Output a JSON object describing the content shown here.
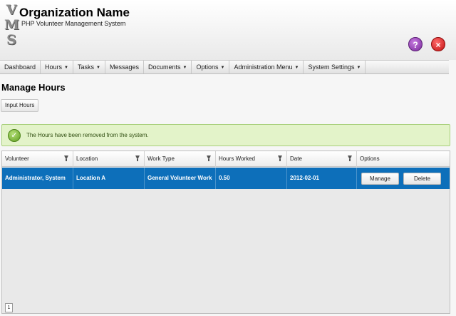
{
  "header": {
    "logo_letters": [
      "V",
      "M",
      "S"
    ],
    "org_name": "Organization Name",
    "subtitle": "PHP Volunteer Management System",
    "top_right": "",
    "help_label": "?",
    "close_label": "×"
  },
  "nav": {
    "items": [
      {
        "label": "Dashboard",
        "caret": ""
      },
      {
        "label": "Hours",
        "caret": "▼"
      },
      {
        "label": "Tasks",
        "caret": "▼"
      },
      {
        "label": "Messages",
        "caret": ""
      },
      {
        "label": "Documents",
        "caret": "▼"
      },
      {
        "label": "Options",
        "caret": "▼"
      },
      {
        "label": "Administration Menu",
        "caret": "▼"
      },
      {
        "label": "System Settings",
        "caret": "▼"
      }
    ]
  },
  "page": {
    "title": "Manage Hours",
    "input_hours_label": "Input Hours"
  },
  "alert": {
    "message": "The Hours have been removed from the system.",
    "icon": "check-icon",
    "check_glyph": "✓"
  },
  "grid": {
    "columns": [
      "Volunteer",
      "Location",
      "Work Type",
      "Hours Worked",
      "Date",
      "Options"
    ],
    "rows": [
      {
        "volunteer": "Administrator, System",
        "location": "Location A",
        "work_type": "General Volunteer Work",
        "hours_worked": "0.50",
        "date": "2012-02-01",
        "manage_label": "Manage",
        "delete_label": "Delete"
      }
    ],
    "page_number": "1"
  },
  "colors": {
    "selected_row": "#0d6fba",
    "alert_bg": "#e3f3c9",
    "help_button": "#7a2a9b",
    "close_button": "#c21010"
  }
}
